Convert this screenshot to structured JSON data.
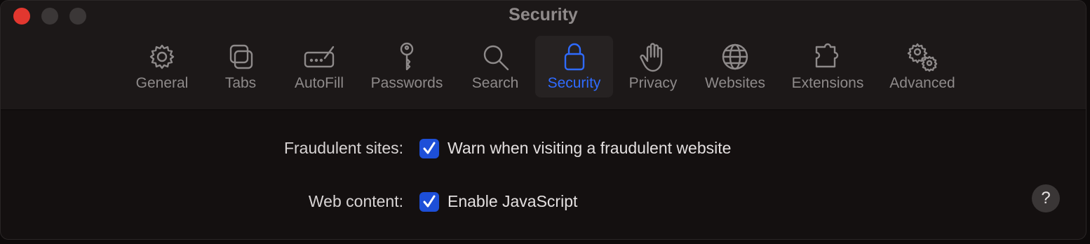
{
  "window": {
    "title": "Security"
  },
  "toolbar": {
    "tabs": [
      {
        "label": "General",
        "icon": "gear-icon"
      },
      {
        "label": "Tabs",
        "icon": "tabs-icon"
      },
      {
        "label": "AutoFill",
        "icon": "autofill-icon"
      },
      {
        "label": "Passwords",
        "icon": "key-icon"
      },
      {
        "label": "Search",
        "icon": "search-icon"
      },
      {
        "label": "Security",
        "icon": "lock-icon",
        "active": true
      },
      {
        "label": "Privacy",
        "icon": "hand-icon"
      },
      {
        "label": "Websites",
        "icon": "globe-icon"
      },
      {
        "label": "Extensions",
        "icon": "puzzle-icon"
      },
      {
        "label": "Advanced",
        "icon": "gears-icon"
      }
    ]
  },
  "settings": {
    "fraudulent": {
      "label": "Fraudulent sites:",
      "checkbox_label": "Warn when visiting a fraudulent website",
      "checked": true
    },
    "web_content": {
      "label": "Web content:",
      "checkbox_label": "Enable JavaScript",
      "checked": true
    }
  },
  "help": {
    "label": "?"
  },
  "colors": {
    "accent": "#2f6bff",
    "checkbox": "#1d4fd8",
    "close": "#e2372f"
  }
}
